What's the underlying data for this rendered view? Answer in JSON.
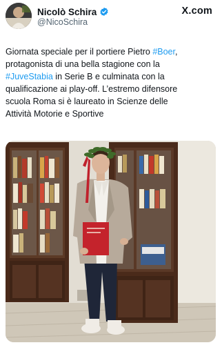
{
  "author": {
    "display_name": "Nicolò Schira",
    "handle": "@NicoSchira",
    "verified": true,
    "avatar_icon": "avatar-photo-icon"
  },
  "brand": {
    "label": "X.com"
  },
  "tweet": {
    "lines": [
      [
        "Giornata speciale per il portiere Pietro ",
        "#Boer",
        ","
      ],
      [
        "protagonista di una bella stagione con la",
        "",
        ""
      ],
      [
        "",
        "#JuveStabia",
        " in Serie B e culminata con la"
      ],
      [
        "qualificazione ai play-off. L’estremo difensore",
        "",
        ""
      ],
      [
        "scuola Roma si è laureato in Scienze delle",
        "",
        ""
      ],
      [
        "Attività Motorie e Sportive",
        "",
        ""
      ]
    ]
  },
  "photo": {
    "description_icon": "graduation-photo"
  },
  "colors": {
    "text": "#0f1419",
    "secondary": "#536471",
    "link": "#1d9bf0",
    "verified": "#1d9bf0"
  }
}
